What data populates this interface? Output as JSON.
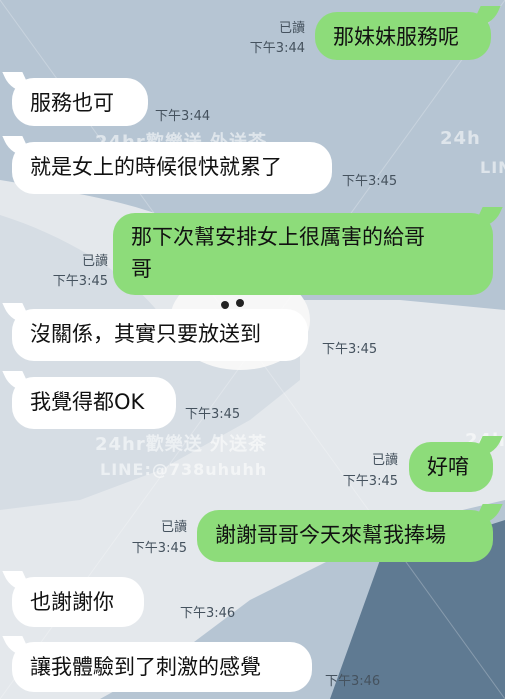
{
  "watermark": {
    "line1": "24hr歡樂送 外送茶",
    "line2": "LINE:@738uhuhh",
    "short1": "24h",
    "short2": "LINE"
  },
  "messages": [
    {
      "side": "out",
      "text": "那妹妹服務呢",
      "read": "已讀",
      "time": "下午3:44"
    },
    {
      "side": "in",
      "text": "服務也可",
      "time": "下午3:44"
    },
    {
      "side": "in",
      "text": "就是女上的時候很快就累了",
      "time": "下午3:45"
    },
    {
      "side": "out",
      "line1": "那下次幫安排女上很厲害的給哥",
      "line2": "哥",
      "read": "已讀",
      "time": "下午3:45"
    },
    {
      "side": "in",
      "text": "沒關係，其實只要放送到",
      "time": "下午3:45"
    },
    {
      "side": "in",
      "text": "我覺得都OK",
      "time": "下午3:45"
    },
    {
      "side": "out",
      "text": "好唷",
      "read": "已讀",
      "time": "下午3:45"
    },
    {
      "side": "out",
      "text": "謝謝哥哥今天來幫我捧場",
      "read": "已讀",
      "time": "下午3:45"
    },
    {
      "side": "in",
      "text": "也謝謝你",
      "time": "下午3:46"
    },
    {
      "side": "in",
      "text": "讓我體驗到了刺激的感覺",
      "time": "下午3:46"
    }
  ]
}
